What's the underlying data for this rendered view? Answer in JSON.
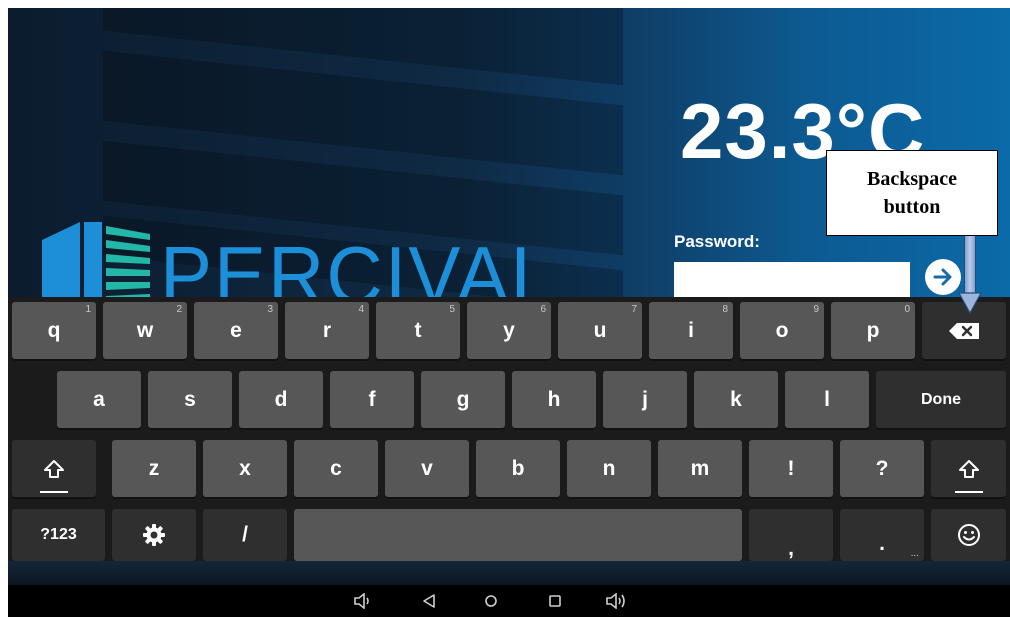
{
  "app": {
    "temperature": "23.3°C",
    "password_label": "Password:",
    "password_value": "",
    "logo_text": "PERCIVAL",
    "brand_color": "#1d8fd8"
  },
  "keyboard": {
    "row1": [
      {
        "label": "q",
        "hint": "1"
      },
      {
        "label": "w",
        "hint": "2"
      },
      {
        "label": "e",
        "hint": "3"
      },
      {
        "label": "r",
        "hint": "4"
      },
      {
        "label": "t",
        "hint": "5"
      },
      {
        "label": "y",
        "hint": "6"
      },
      {
        "label": "u",
        "hint": "7"
      },
      {
        "label": "i",
        "hint": "8"
      },
      {
        "label": "o",
        "hint": "9"
      },
      {
        "label": "p",
        "hint": "0"
      }
    ],
    "row2": [
      "a",
      "s",
      "d",
      "f",
      "g",
      "h",
      "j",
      "k",
      "l"
    ],
    "done_label": "Done",
    "row3": [
      "z",
      "x",
      "c",
      "v",
      "b",
      "n",
      "m",
      "!",
      "?"
    ],
    "symbols_label": "?123",
    "slash_label": "/",
    "comma_label": ",",
    "period_label": ".",
    "period_hint": "..."
  },
  "annotation": {
    "line1": "Backspace",
    "line2": "button"
  },
  "icons": {
    "go": "arrow-right-icon",
    "backspace": "backspace-icon",
    "shift": "shift-icon",
    "settings": "gear-icon",
    "emoji": "smiley-icon",
    "nav": [
      "volume-down-icon",
      "back-icon",
      "home-icon",
      "recents-icon",
      "volume-up-icon"
    ]
  }
}
